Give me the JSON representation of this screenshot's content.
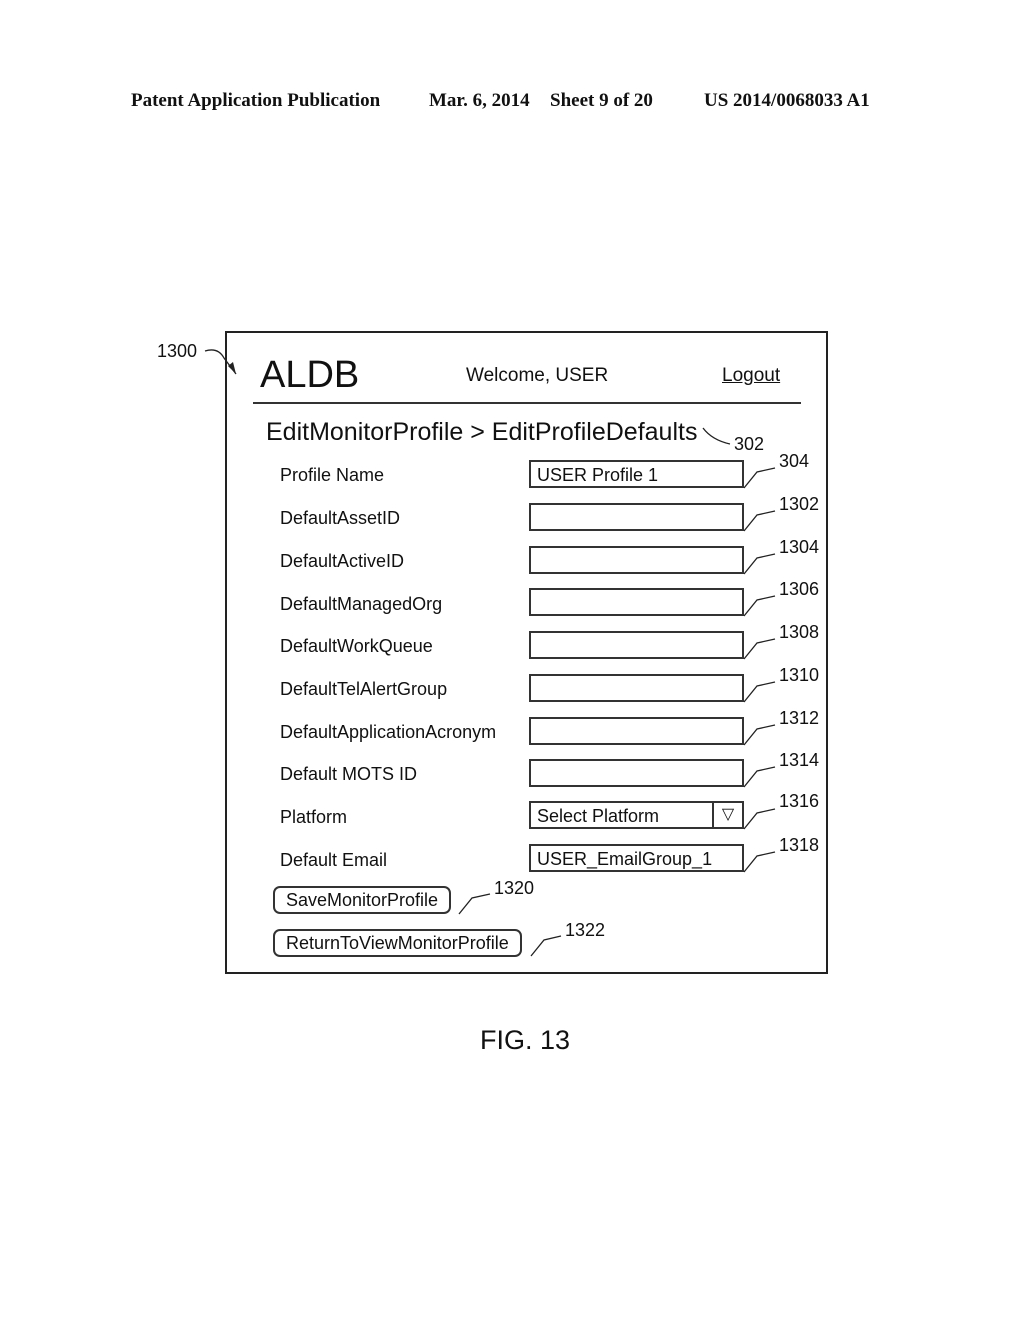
{
  "patent_header": {
    "publication_type": "Patent Application Publication",
    "date": "Mar. 6, 2014",
    "sheet": "Sheet 9 of 20",
    "number": "US 2014/0068033 A1"
  },
  "figure": {
    "reference": "1300",
    "caption": "FIG. 13"
  },
  "app": {
    "title": "ALDB",
    "welcome": "Welcome, USER",
    "logout_label": "Logout",
    "breadcrumb": "EditMonitorProfile > EditProfileDefaults",
    "breadcrumb_ref": "302"
  },
  "form": {
    "fields": [
      {
        "label": "Profile Name",
        "value": "USER Profile 1",
        "ref": "304"
      },
      {
        "label": "DefaultAssetID",
        "value": "",
        "ref": "1302"
      },
      {
        "label": "DefaultActiveID",
        "value": "",
        "ref": "1304"
      },
      {
        "label": "DefaultManagedOrg",
        "value": "",
        "ref": "1306"
      },
      {
        "label": "DefaultWorkQueue",
        "value": "",
        "ref": "1308"
      },
      {
        "label": "DefaultTelAlertGroup",
        "value": "",
        "ref": "1310"
      },
      {
        "label": "DefaultApplicationAcronym",
        "value": "",
        "ref": "1312"
      },
      {
        "label": "Default MOTS ID",
        "value": "",
        "ref": "1314"
      },
      {
        "label": "Platform",
        "value": "Select Platform",
        "ref": "1316",
        "type": "select",
        "icon": "triangle-down-icon",
        "arrow_glyph": "▽"
      },
      {
        "label": "Default Email",
        "value": "USER_EmailGroup_1",
        "ref": "1318"
      }
    ],
    "buttons": [
      {
        "label": "SaveMonitorProfile",
        "ref": "1320"
      },
      {
        "label": "ReturnToViewMonitorProfile",
        "ref": "1322"
      }
    ]
  }
}
